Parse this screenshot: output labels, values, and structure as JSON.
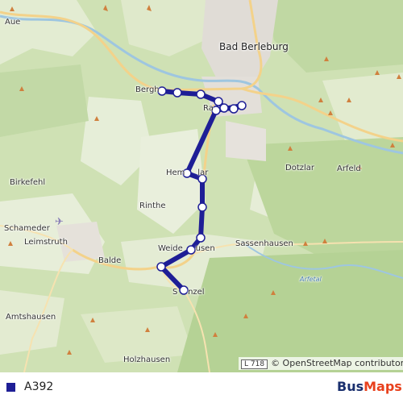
{
  "map": {
    "places": {
      "aue": "Aue",
      "bad_berleburg": "Bad Berleburg",
      "berghausen": "Bergh",
      "raumland": "Ra",
      "dotzlar": "Dotzlar",
      "arfeld": "Arfeld",
      "birkefehl": "Birkefehl",
      "hemschlar": "Hem     lar",
      "rinthe": "Rinthe",
      "schameder": "Schameder",
      "leimstruth": "Leimstruth",
      "balde": "Balde",
      "weidenhausen": "Weide     usen",
      "sassenhausen": "Sassenhausen",
      "arfetal": "Arfetal",
      "amtshausen": "Amtshausen",
      "stuenzel": "S    nzel",
      "holzhausen": "Holzhausen"
    },
    "road_sign": "L 718",
    "attribution": "© OpenStreetMap contributors",
    "route_color": "#1e1e96"
  },
  "legend": {
    "route_name": "A392",
    "route_color": "#1e1e96"
  },
  "brand": {
    "part1": "Bus",
    "part2": "Maps"
  }
}
